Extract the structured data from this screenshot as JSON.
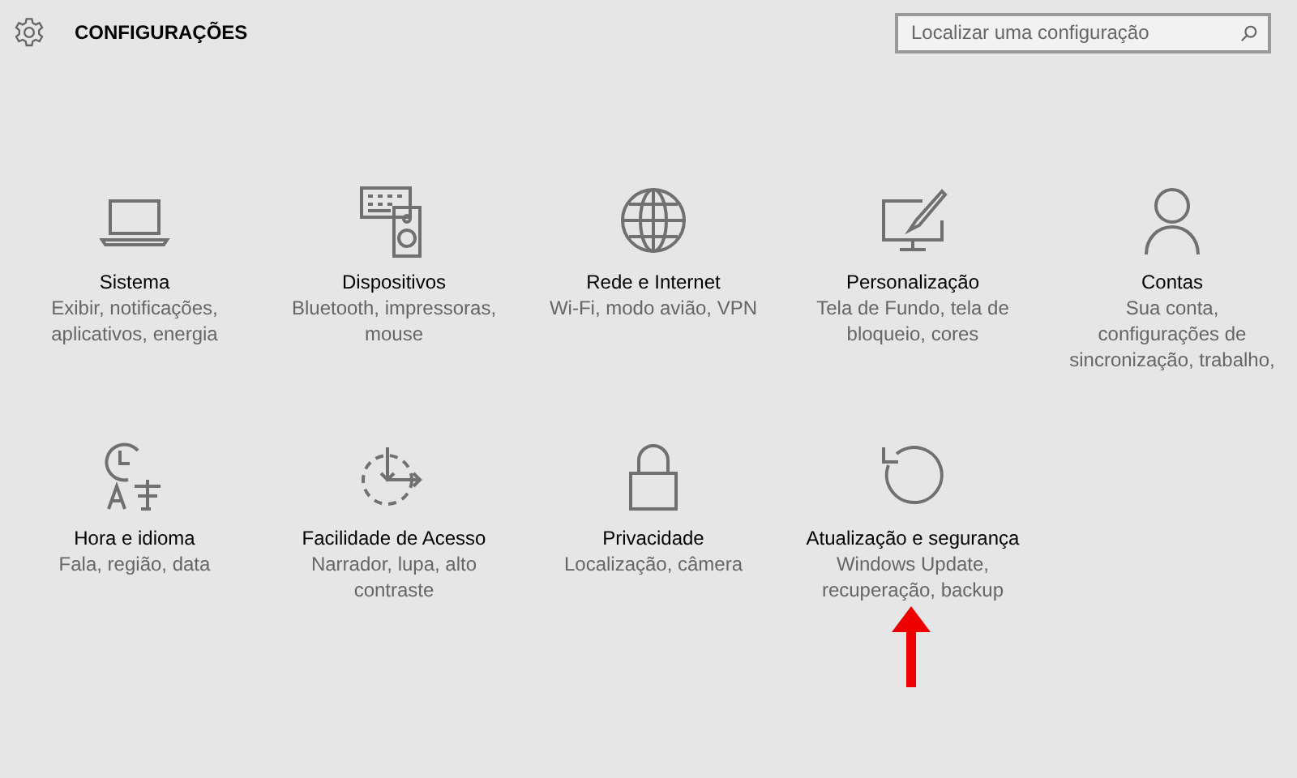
{
  "header": {
    "title": "CONFIGURAÇÕES"
  },
  "search": {
    "placeholder": "Localizar uma configuração"
  },
  "categories": [
    {
      "kind": "laptop",
      "title": "Sistema",
      "description": "Exibir, notificações, aplicativos, energia"
    },
    {
      "kind": "devices",
      "title": "Dispositivos",
      "description": "Bluetooth, impressoras, mouse"
    },
    {
      "kind": "globe",
      "title": "Rede e Internet",
      "description": "Wi-Fi, modo avião, VPN"
    },
    {
      "kind": "paint",
      "title": "Personalização",
      "description": "Tela de Fundo, tela de bloqueio, cores"
    },
    {
      "kind": "person",
      "title": "Contas",
      "description": "Sua conta, configurações de sincronização, trabalho,"
    },
    {
      "kind": "clock",
      "title": "Hora e idioma",
      "description": "Fala, região, data"
    },
    {
      "kind": "access",
      "title": "Facilidade de Acesso",
      "description": "Narrador, lupa, alto contraste"
    },
    {
      "kind": "lock",
      "title": "Privacidade",
      "description": "Localização, câmera"
    },
    {
      "kind": "refresh",
      "title": "Atualização e segurança",
      "description": "Windows Update, recuperação, backup"
    }
  ]
}
